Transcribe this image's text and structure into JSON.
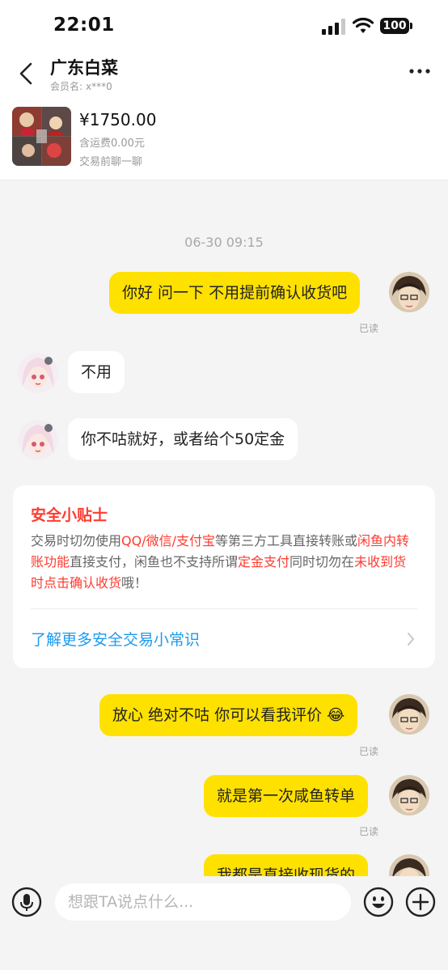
{
  "status_bar": {
    "time": "22:01",
    "battery": "100"
  },
  "header": {
    "back_icon": "chevron-left-icon",
    "name": "广东白菜",
    "member_label": "会员名:",
    "member_value": "x***0",
    "more_icon": "more-horizontal-icon"
  },
  "product": {
    "price": "¥1750.00",
    "shipping": "含运费0.00元",
    "note": "交易前聊一聊"
  },
  "chat": {
    "timestamp": "06-30 09:15",
    "messages": [
      {
        "side": "out",
        "text": "你好 问一下 不用提前确认收货吧",
        "status": "已读"
      },
      {
        "side": "in",
        "text": "不用"
      },
      {
        "side": "in",
        "text": "你不咕就好，或者给个50定金"
      },
      {
        "side": "out",
        "text": "放心 绝对不咕 你可以看我评价 😂",
        "status": "已读"
      },
      {
        "side": "out",
        "text": "就是第一次咸鱼转单",
        "status": "已读"
      },
      {
        "side": "out",
        "text": "我都是直接收现货的"
      }
    ]
  },
  "safety": {
    "title": "安全小贴士",
    "t1": "交易时切勿使用",
    "r1": "QQ/微信/支付宝",
    "t2": "等第三方工具直接转账或",
    "r2": "闲鱼内转账功能",
    "t3": "直接支付，闲鱼也不支持所谓",
    "r3": "定金支付",
    "t4": "同时切勿在",
    "r4": "未收到货时点击确认收货",
    "t5": "哦！",
    "link": "了解更多安全交易小常识",
    "colors": {
      "warning": "#ff3b30",
      "link": "#1a9bf0"
    }
  },
  "input": {
    "placeholder": "想跟TA说点什么...",
    "mic_icon": "microphone-icon",
    "emoji_icon": "emoji-icon",
    "plus_icon": "plus-icon"
  },
  "colors": {
    "outgoing_bubble": "#ffe100",
    "incoming_bubble": "#ffffff",
    "background": "#f4f4f4"
  }
}
